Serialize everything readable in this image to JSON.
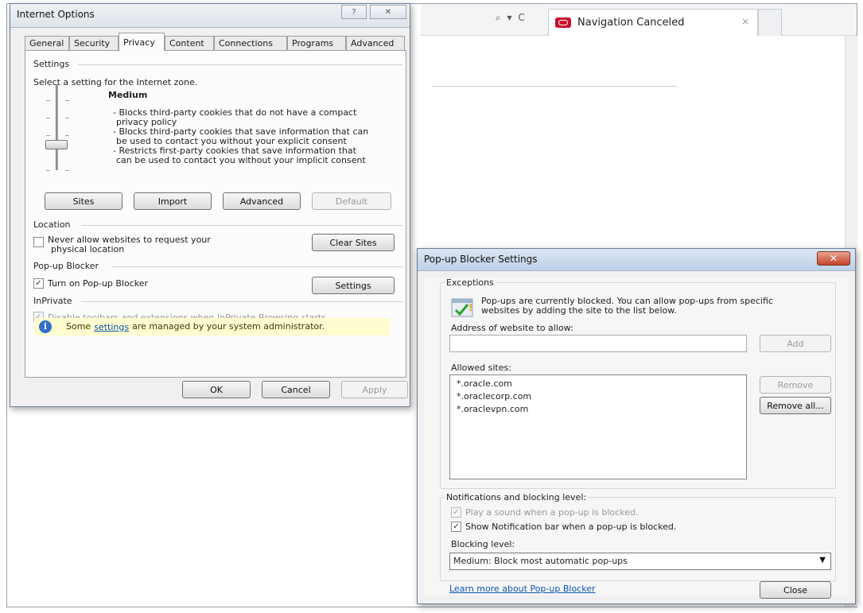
{
  "browser": {
    "tab_title": "Navigation Canceled",
    "tab_close": "×",
    "address_controls": "⌕ ▾ C"
  },
  "internet_options": {
    "title": "Internet Options",
    "help_button": "?",
    "close_button": "✕",
    "tabs": [
      "General",
      "Security",
      "Privacy",
      "Content",
      "Connections",
      "Programs",
      "Advanced"
    ],
    "active_tab": "Privacy",
    "settings_section": "Settings",
    "settings_intro": "Select a setting for the Internet zone.",
    "level_name": "Medium",
    "level_description": [
      "- Blocks third-party cookies that do not have a compact",
      "privacy policy",
      "- Blocks third-party cookies that save information that can",
      "be used to contact you without your explicit consent",
      "- Restricts first-party cookies that save information that",
      "can be used to contact you without your implicit consent"
    ],
    "buttons": {
      "sites": "Sites",
      "import": "Import",
      "advanced": "Advanced",
      "default": "Default"
    },
    "location_section": "Location",
    "location_checkbox_line1": "Never allow websites to request your",
    "location_checkbox_line2": "physical location",
    "location_checked": false,
    "clear_sites": "Clear Sites",
    "popup_section": "Pop-up Blocker",
    "popup_checkbox": "Turn on Pop-up Blocker",
    "popup_checked": true,
    "popup_settings": "Settings",
    "inprivate_section": "InPrivate",
    "inprivate_checkbox": "Disable toolbars and extensions when InPrivate Browsing starts",
    "inprivate_checked": true,
    "info_prefix": "Some",
    "info_link": "settings",
    "info_suffix": "are managed by your system administrator.",
    "ok": "OK",
    "cancel": "Cancel",
    "apply": "Apply"
  },
  "popup_blocker": {
    "title": "Pop-up Blocker Settings",
    "close_button": "✕",
    "exceptions_section": "Exceptions",
    "exceptions_text_line1": "Pop-ups are currently blocked.  You can allow pop-ups from specific",
    "exceptions_text_line2": "websites by adding the site to the list below.",
    "address_label": "Address of website to allow:",
    "address_value": "",
    "add_button": "Add",
    "allowed_label": "Allowed sites:",
    "allowed_sites": [
      "*.oracle.com",
      "*.oraclecorp.com",
      "*.oraclevpn.com"
    ],
    "remove_button": "Remove",
    "remove_all_button": "Remove all...",
    "notifications_section": "Notifications and blocking level:",
    "play_sound": "Play a sound when a pop-up is blocked.",
    "play_sound_checked": true,
    "show_bar": "Show Notification bar when a pop-up is blocked.",
    "show_bar_checked": true,
    "blocking_level_label": "Blocking level:",
    "blocking_level_value": "Medium: Block most automatic pop-ups",
    "learn_more": "Learn more about Pop-up Blocker",
    "close": "Close"
  }
}
